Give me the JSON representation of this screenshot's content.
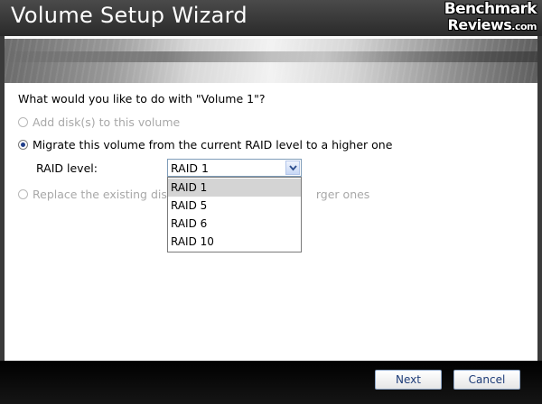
{
  "window": {
    "title": "Volume Setup Wizard",
    "watermark_line1": "Benchmark",
    "watermark_line2": "Reviews",
    "watermark_suffix": ".com"
  },
  "content": {
    "question": "What would you like to do with \"Volume 1\"?",
    "options": [
      {
        "label": "Add disk(s) to this volume",
        "enabled": false,
        "checked": false
      },
      {
        "label": "Migrate this volume from the current RAID level to a higher one",
        "enabled": true,
        "checked": true
      },
      {
        "label": "Replace the existing disks with larger ones",
        "enabled": false,
        "checked": false
      }
    ],
    "raid_level_label": "RAID level:",
    "raid_select": {
      "value": "RAID 1",
      "arrow_icon": "chevron-down-icon",
      "options": [
        "RAID 1",
        "RAID 5",
        "RAID 6",
        "RAID 10"
      ],
      "highlighted": "RAID 1"
    },
    "option3_visible_left": "Replace the existing dis",
    "option3_visible_right": "rger ones"
  },
  "footer": {
    "next_label": "Next",
    "cancel_label": "Cancel"
  },
  "colors": {
    "accent": "#1f3d8a",
    "button_text": "#1e3c78",
    "disabled_text": "#a8a8a8"
  }
}
